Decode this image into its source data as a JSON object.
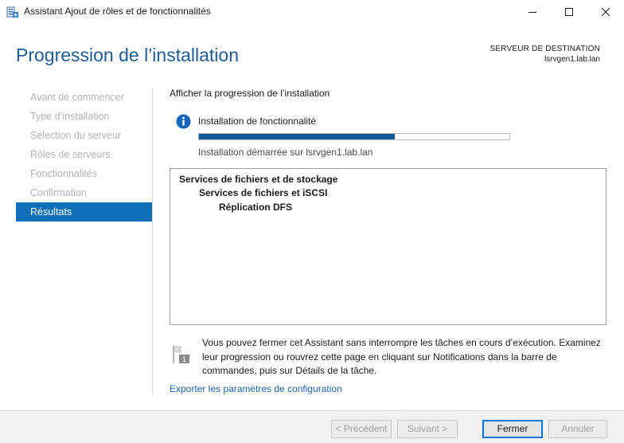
{
  "window": {
    "title": "Assistant Ajout de rôles et de fonctionnalités",
    "app_icon": "server-manager-icon",
    "controls": [
      "minimize-icon",
      "maximize-icon",
      "close-icon"
    ]
  },
  "header": {
    "page_title": "Progression de l’installation",
    "destination_label": "SERVEUR DE DESTINATION",
    "destination_server": "lsrvgen1.lab.lan"
  },
  "nav": {
    "items": [
      {
        "label": "Avant de commencer",
        "active": false
      },
      {
        "label": "Type d’installation",
        "active": false
      },
      {
        "label": "Sélection du serveur",
        "active": false
      },
      {
        "label": "Rôles de serveurs",
        "active": false
      },
      {
        "label": "Fonctionnalités",
        "active": false
      },
      {
        "label": "Confirmation",
        "active": false
      },
      {
        "label": "Résultats",
        "active": true
      }
    ]
  },
  "main": {
    "section_heading": "Afficher la progression de l’installation",
    "info_icon": "info-icon",
    "install_label": "Installation de fonctionnalité",
    "progress_percent": 63,
    "install_status": "Installation démarrée sur lsrvgen1.lab.lan",
    "features": [
      {
        "label": "Services de fichiers et de stockage",
        "level": 0
      },
      {
        "label": "Services de fichiers et iSCSI",
        "level": 1
      },
      {
        "label": "Réplication DFS",
        "level": 2
      }
    ],
    "note_icon": "notification-flag-icon",
    "note": "Vous pouvez fermer cet Assistant sans interrompre les tâches en cours d’exécution. Examinez leur progression ou rouvrez cette page en cliquant sur Notifications dans la barre de commandes, puis sur Détails de la tâche.",
    "export_link": "Exporter les paramètres de configuration"
  },
  "footer": {
    "previous": "< Précédent",
    "next": "Suivant >",
    "close": "Fermer",
    "cancel": "Annuler"
  },
  "colors": {
    "accent": "#0d6fb8",
    "title": "#1e5c9a",
    "progress": "#0f5a96",
    "link": "#1d64b0"
  }
}
